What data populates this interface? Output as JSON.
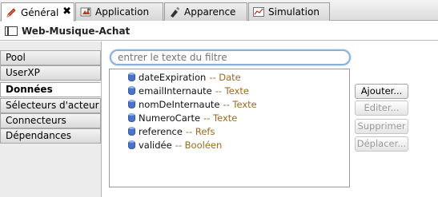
{
  "tabs": [
    {
      "label": "Général",
      "icon": "pencil-icon",
      "active": true,
      "closable": true
    },
    {
      "label": "Application",
      "icon": "application-icon",
      "active": false,
      "closable": false
    },
    {
      "label": "Apparence",
      "icon": "appearance-icon",
      "active": false,
      "closable": false
    },
    {
      "label": "Simulation",
      "icon": "chart-icon",
      "active": false,
      "closable": false
    }
  ],
  "tab_close_glyph": "✖",
  "header": {
    "title": "Web-Musique-Achat"
  },
  "nav": {
    "items": [
      {
        "label": "Pool",
        "selected": false
      },
      {
        "label": "UserXP",
        "selected": false
      },
      {
        "label": "Données",
        "selected": true
      },
      {
        "label": "Sélecteurs d'acteur",
        "selected": false
      },
      {
        "label": "Connecteurs",
        "selected": false
      },
      {
        "label": "Dépendances",
        "selected": false
      }
    ]
  },
  "filter": {
    "placeholder": "entrer le texte du filtre",
    "value": ""
  },
  "data_items": [
    {
      "name": "dateExpiration",
      "type": "-- Date"
    },
    {
      "name": "emailInternaute",
      "type": "-- Texte"
    },
    {
      "name": "nomDeInternaute",
      "type": "-- Texte"
    },
    {
      "name": "NumeroCarte",
      "type": "-- Texte"
    },
    {
      "name": "reference",
      "type": "-- Refs"
    },
    {
      "name": "validée",
      "type": "-- Booléen"
    }
  ],
  "buttons": {
    "add": {
      "label": "Ajouter...",
      "enabled": true
    },
    "edit": {
      "label": "Editer...",
      "enabled": false
    },
    "delete": {
      "label": "Supprimer",
      "enabled": false
    },
    "move": {
      "label": "Déplacer...",
      "enabled": false
    }
  },
  "colors": {
    "accent_focus": "#8bb0da",
    "type_text": "#9a6a1f",
    "db_icon": "#3a63b8"
  }
}
